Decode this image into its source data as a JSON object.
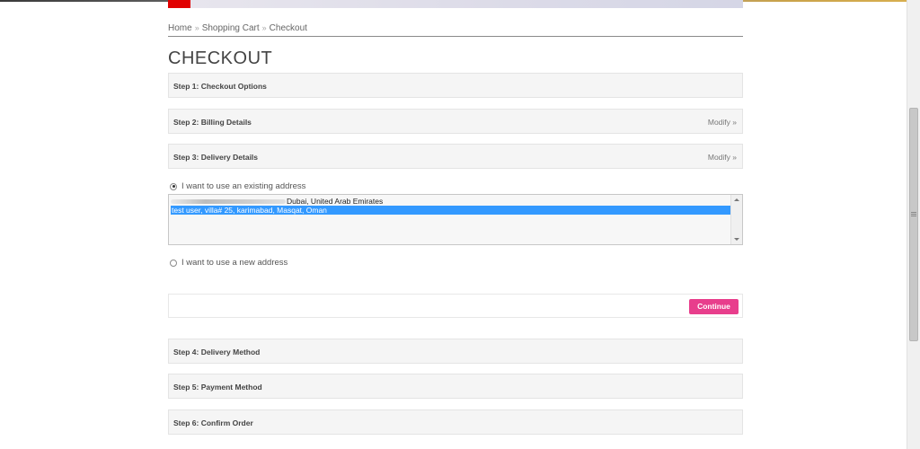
{
  "breadcrumb": [
    "Home",
    "Shopping Cart",
    "Checkout"
  ],
  "breadcrumb_separator": "»",
  "page_title": "CHECKOUT",
  "steps": [
    {
      "title": "Step 1: Checkout Options",
      "modify": ""
    },
    {
      "title": "Step 2: Billing Details",
      "modify": "Modify »"
    },
    {
      "title": "Step 3: Delivery Details",
      "modify": "Modify »"
    },
    {
      "title": "Step 4: Delivery Method",
      "modify": ""
    },
    {
      "title": "Step 5: Payment Method",
      "modify": ""
    },
    {
      "title": "Step 6: Confirm Order",
      "modify": ""
    }
  ],
  "delivery": {
    "existing_label": "I want to use an existing address",
    "new_label": "I want to use a new address",
    "selected_option": "existing",
    "addresses": [
      "Dubai, United Arab Emirates",
      "test user, villa# 25, karimabad, Masqat, Oman"
    ],
    "selected_address_index": 1,
    "continue_label": "Continue"
  },
  "colors": {
    "continue_button": "#e83e8c",
    "selected_row": "#3399ff",
    "banner_red": "#e10000"
  }
}
